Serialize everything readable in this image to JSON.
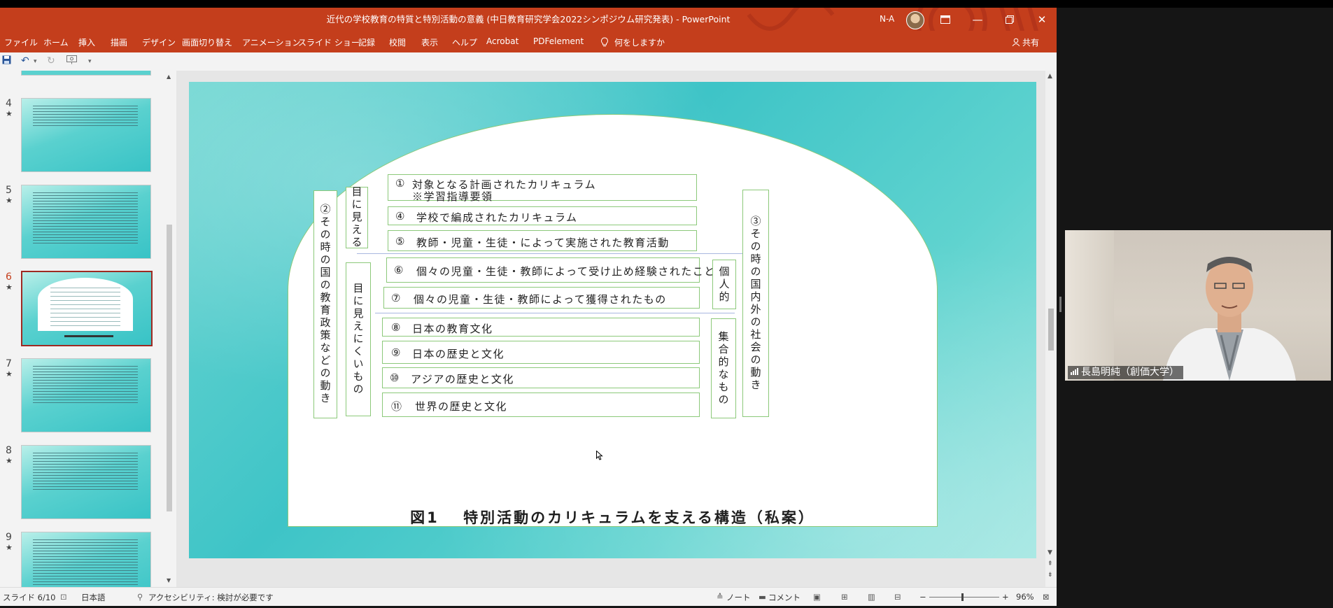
{
  "window": {
    "title": "近代の学校教育の特質と特別活動の意義 (中日教育研究学会2022シンポジウム研究発表)  -  PowerPoint",
    "user": "N-A",
    "share": "共有"
  },
  "menu": {
    "items": [
      "ファイル",
      "ホーム",
      "挿入",
      "描画",
      "デザイン",
      "画面切り替え",
      "アニメーション",
      "スライド ショー",
      "記録",
      "校閲",
      "表示",
      "ヘルプ",
      "Acrobat",
      "PDFelement"
    ],
    "tell_me": "何をしますか"
  },
  "thumbnails": [
    {
      "num": "4",
      "star": "★"
    },
    {
      "num": "5",
      "star": "★"
    },
    {
      "num": "6",
      "star": "★"
    },
    {
      "num": "7",
      "star": "★"
    },
    {
      "num": "8",
      "star": "★"
    },
    {
      "num": "9",
      "star": "★"
    }
  ],
  "slide": {
    "left_box": "②その時の国の教育政策などの動き",
    "visible_box": "目に見える",
    "invisible_box": "目に見えにくいもの",
    "individual_box": "個人的",
    "collective_box": "集合的なもの",
    "right_box": "③その時の国内外の社会の動き",
    "item1_num": "①",
    "item1_line1": "対象となる計画されたカリキュラム",
    "item1_line2": "※学習指導要領",
    "item4_num": "④",
    "item4": "学校で編成されたカリキュラム",
    "item5_num": "⑤",
    "item5": "教師・児童・生徒・によって実施された教育活動",
    "item6_num": "⑥",
    "item6": "個々の児童・生徒・教師によって受け止め経験されたこと",
    "item7_num": "⑦",
    "item7": "個々の児童・生徒・教師によって獲得されたもの",
    "item8_num": "⑧",
    "item8": "日本の教育文化",
    "item9_num": "⑨",
    "item9": "日本の歴史と文化",
    "item10_num": "⑩",
    "item10": "アジアの歴史と文化",
    "item11_num": "⑪",
    "item11": "世界の歴史と文化",
    "caption": "図1　 特別活動のカリキュラムを支える構造（私案）"
  },
  "status": {
    "slide_pos": "スライド 6/10",
    "language": "日本語",
    "accessibility": "アクセシビリティ: 検討が必要です",
    "notes": "ノート",
    "comments": "コメント",
    "zoom": "96%",
    "zoom_minus": "−",
    "zoom_plus": "+"
  },
  "video": {
    "participant_name": "長島明純（創価大学）"
  }
}
